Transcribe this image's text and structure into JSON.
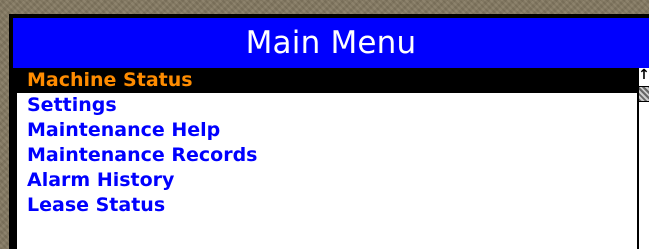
{
  "window": {
    "title": "Main Menu"
  },
  "menu": {
    "items": [
      {
        "label": "Machine Status",
        "selected": true
      },
      {
        "label": "Settings",
        "selected": false
      },
      {
        "label": "Maintenance Help",
        "selected": false
      },
      {
        "label": "Maintenance Records",
        "selected": false
      },
      {
        "label": "Alarm History",
        "selected": false
      },
      {
        "label": "Lease Status",
        "selected": false
      }
    ]
  },
  "scrollbar": {
    "up_icon": "arrow-up-icon"
  },
  "colors": {
    "title_bg": "#0000fe",
    "title_text": "#ffffff",
    "item_text": "#0000fe",
    "selected_bg": "#000000",
    "selected_text": "#ff8c00"
  }
}
